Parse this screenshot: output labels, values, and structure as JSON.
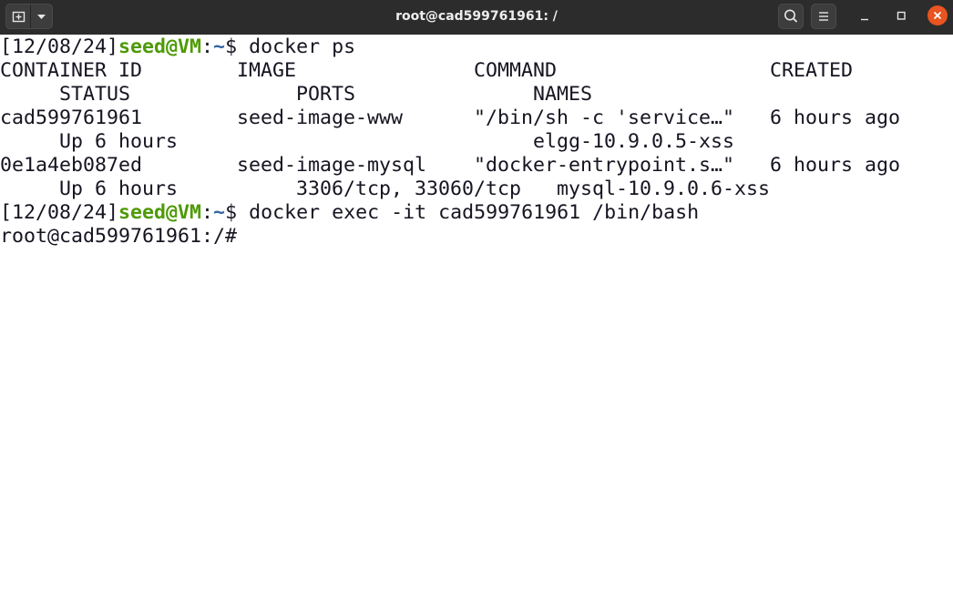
{
  "window": {
    "title": "root@cad599761961: /"
  },
  "toolbar": {
    "new_tab_icon": "new-tab-icon",
    "menu_icon": "dropdown-chevron-icon",
    "search_icon": "search-icon",
    "hamburger_icon": "hamburger-menu-icon",
    "minimize_icon": "minimize-icon",
    "maximize_icon": "maximize-icon",
    "close_icon": "close-icon",
    "close_color": "#e95420",
    "titlebar_color": "#2c2c2c"
  },
  "terminal": {
    "prompt_date": "[12/08/24]",
    "prompt_user": "seed@VM",
    "prompt_colon": ":",
    "prompt_path": "~",
    "prompt_dollar": "$ ",
    "cmd1": "docker ps",
    "header1": "CONTAINER ID        IMAGE               COMMAND                  CREATED",
    "header2": "     STATUS              PORTS               NAMES",
    "row1a": "cad599761961        seed-image-www      \"/bin/sh -c 'service…\"   6 hours ago",
    "row1b": "     Up 6 hours                              elgg-10.9.0.5-xss",
    "row2a": "0e1a4eb087ed        seed-image-mysql    \"docker-entrypoint.s…\"   6 hours ago",
    "row2b": "     Up 6 hours          3306/tcp, 33060/tcp   mysql-10.9.0.6-xss",
    "cmd2": "docker exec -it cad599761961 /bin/bash",
    "root_prompt": "root@cad599761961:/#",
    "user_color": "#4e9a06",
    "path_color": "#3465a4",
    "text_color": "#171421",
    "background": "#ffffff"
  }
}
